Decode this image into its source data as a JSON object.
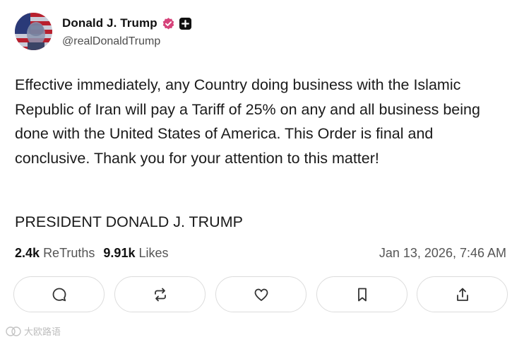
{
  "author": {
    "display_name": "Donald J. Trump",
    "handle": "@realDonaldTrump",
    "verified_color": "#d6437a"
  },
  "post": {
    "text": "Effective immediately, any Country doing business with the Islamic Republic of Iran will pay a Tariff of 25% on any and all business being done with the United States of America. This Order is final and conclusive. Thank you for your attention to this matter!",
    "signature": "PRESIDENT DONALD J. TRUMP"
  },
  "stats": {
    "retruths_count": "2.4k",
    "retruths_label": "ReTruths",
    "likes_count": "9.91k",
    "likes_label": "Likes",
    "timestamp": "Jan 13, 2026, 7:46 AM"
  },
  "actions": [
    {
      "name": "reply",
      "icon": "comment-icon"
    },
    {
      "name": "retruth",
      "icon": "repost-icon"
    },
    {
      "name": "like",
      "icon": "heart-icon"
    },
    {
      "name": "bookmark",
      "icon": "bookmark-icon"
    },
    {
      "name": "share",
      "icon": "share-icon"
    }
  ],
  "watermark": {
    "text": "大欧路语"
  }
}
